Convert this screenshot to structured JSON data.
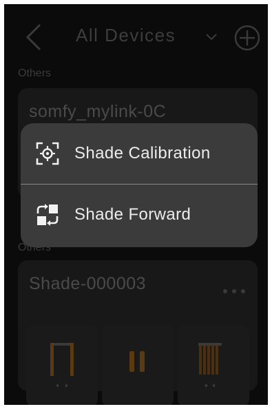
{
  "header": {
    "title": "All Devices"
  },
  "sections": [
    {
      "label": "Others",
      "device_name": "somfy_mylink-0C"
    },
    {
      "label": "Others",
      "device_name": "Shade-000003"
    }
  ],
  "popup_menu": {
    "items": [
      {
        "label": "Shade Calibration",
        "icon": "calibration-icon"
      },
      {
        "label": "Shade Forward",
        "icon": "forward-icon"
      }
    ]
  },
  "colors": {
    "background": "#0b0b0b",
    "popup": "#3b3b3b",
    "accent_bar": "#5a3a10"
  }
}
